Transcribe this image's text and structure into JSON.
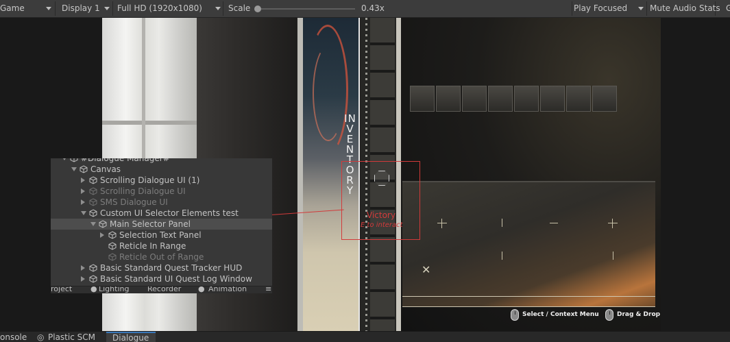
{
  "toolbar": {
    "game_label": "Game",
    "display": "Display 1",
    "resolution": "Full HD (1920x1080)",
    "scale_label": "Scale",
    "scale_value": "0.43x",
    "play_mode": "Play Focused",
    "mute_audio": "Mute Audio",
    "stats": "Stats",
    "gizmos_partial": "G"
  },
  "game": {
    "inventory_label": "INVENTORY",
    "selector": {
      "name": "Victory",
      "prompt": "E to interact"
    },
    "hints": [
      {
        "label": "Select / Context Menu",
        "icon": "mouse-icon"
      },
      {
        "label": "Drag & Drop",
        "icon": "mouse-icon"
      }
    ],
    "slot_count": 8
  },
  "hierarchy": {
    "rows": [
      {
        "label": "#Dialogue Manager#",
        "dim": false,
        "expand": "down"
      },
      {
        "label": "Canvas",
        "dim": false,
        "expand": "down"
      },
      {
        "label": "Scrolling Dialogue UI (1)",
        "dim": false,
        "expand": "right"
      },
      {
        "label": "Scrolling Dialogue UI",
        "dim": true,
        "expand": "right"
      },
      {
        "label": "SMS Dialogue UI",
        "dim": true,
        "expand": "right"
      },
      {
        "label": "Custom UI Selector Elements test",
        "dim": false,
        "expand": "down"
      },
      {
        "label": "Main Selector Panel",
        "dim": false,
        "expand": "down",
        "selected": true
      },
      {
        "label": "Selection Text Panel",
        "dim": false,
        "expand": "right"
      },
      {
        "label": "Reticle In Range",
        "dim": false,
        "expand": "none"
      },
      {
        "label": "Reticle Out of Range",
        "dim": true,
        "expand": "none"
      },
      {
        "label": "Basic Standard Quest Tracker HUD",
        "dim": false,
        "expand": "right"
      },
      {
        "label": "Basic Standard UI Quest Log Window",
        "dim": false,
        "expand": "right"
      }
    ],
    "tabs": [
      "roject",
      "Lighting",
      "Recorder",
      "Animation"
    ]
  },
  "bottom_tabs": [
    "onsole",
    "Plastic SCM",
    "Dialogue"
  ],
  "colors": {
    "accent": "#3a79bb",
    "selector_red": "#d23a3a",
    "editor_bg": "#383838",
    "toolbar_bg": "#3c3c3c"
  }
}
